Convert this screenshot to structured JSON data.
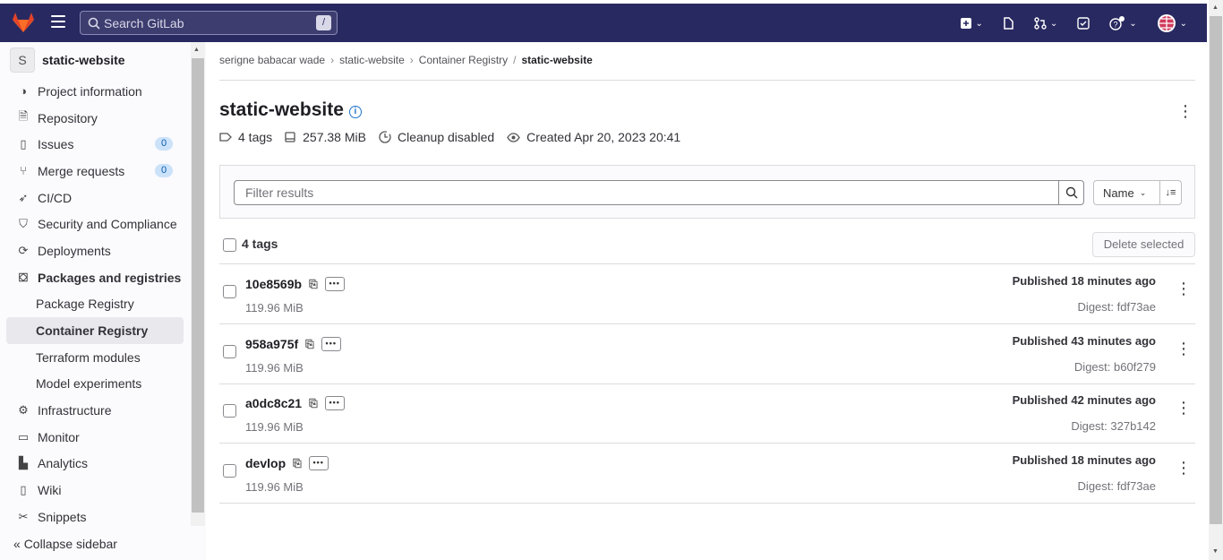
{
  "header": {
    "search_placeholder": "Search GitLab",
    "search_shortcut": "/"
  },
  "sidebar": {
    "project_avatar": "S",
    "project_name": "static-website",
    "items": [
      {
        "label": "Project information",
        "icon": "info-icon"
      },
      {
        "label": "Repository",
        "icon": "doc-icon"
      },
      {
        "label": "Issues",
        "icon": "issues-icon",
        "badge": "0"
      },
      {
        "label": "Merge requests",
        "icon": "merge-request-icon",
        "badge": "0"
      },
      {
        "label": "CI/CD",
        "icon": "rocket-icon"
      },
      {
        "label": "Security and Compliance",
        "icon": "shield-icon"
      },
      {
        "label": "Deployments",
        "icon": "deployments-icon"
      },
      {
        "label": "Packages and registries",
        "icon": "package-icon"
      },
      {
        "label": "Package Registry"
      },
      {
        "label": "Container Registry"
      },
      {
        "label": "Terraform modules"
      },
      {
        "label": "Model experiments"
      },
      {
        "label": "Infrastructure",
        "icon": "cloud-gear-icon"
      },
      {
        "label": "Monitor",
        "icon": "monitor-icon"
      },
      {
        "label": "Analytics",
        "icon": "chart-icon"
      },
      {
        "label": "Wiki",
        "icon": "book-icon"
      },
      {
        "label": "Snippets",
        "icon": "scissors-icon"
      }
    ],
    "collapse_label": "Collapse sidebar"
  },
  "breadcrumb": {
    "items": [
      "serigne babacar wade",
      "static-website",
      "Container Registry",
      "static-website"
    ],
    "separators": [
      "›",
      "›",
      "/"
    ]
  },
  "page": {
    "title": "static-website",
    "info_glyph": "i",
    "meta": {
      "tags": "4 tags",
      "size": "257.38 MiB",
      "cleanup": "Cleanup disabled",
      "created": "Created Apr 20, 2023 20:41"
    }
  },
  "filter": {
    "placeholder": "Filter results",
    "sort_label": "Name"
  },
  "list": {
    "select_all_label": "4 tags",
    "delete_selected_label": "Delete selected",
    "rows": [
      {
        "tag": "10e8569b",
        "size": "119.96 MiB",
        "published": "Published 18 minutes ago",
        "digest": "Digest: fdf73ae"
      },
      {
        "tag": "958a975f",
        "size": "119.96 MiB",
        "published": "Published 43 minutes ago",
        "digest": "Digest: b60f279"
      },
      {
        "tag": "a0dc8c21",
        "size": "119.96 MiB",
        "published": "Published 42 minutes ago",
        "digest": "Digest: 327b142"
      },
      {
        "tag": "devlop",
        "size": "119.96 MiB",
        "published": "Published 18 minutes ago",
        "digest": "Digest: fdf73ae"
      }
    ]
  },
  "colors": {
    "topbar": "#292961",
    "link": "#1f75cb",
    "badge_bg": "#cbe2f9"
  }
}
